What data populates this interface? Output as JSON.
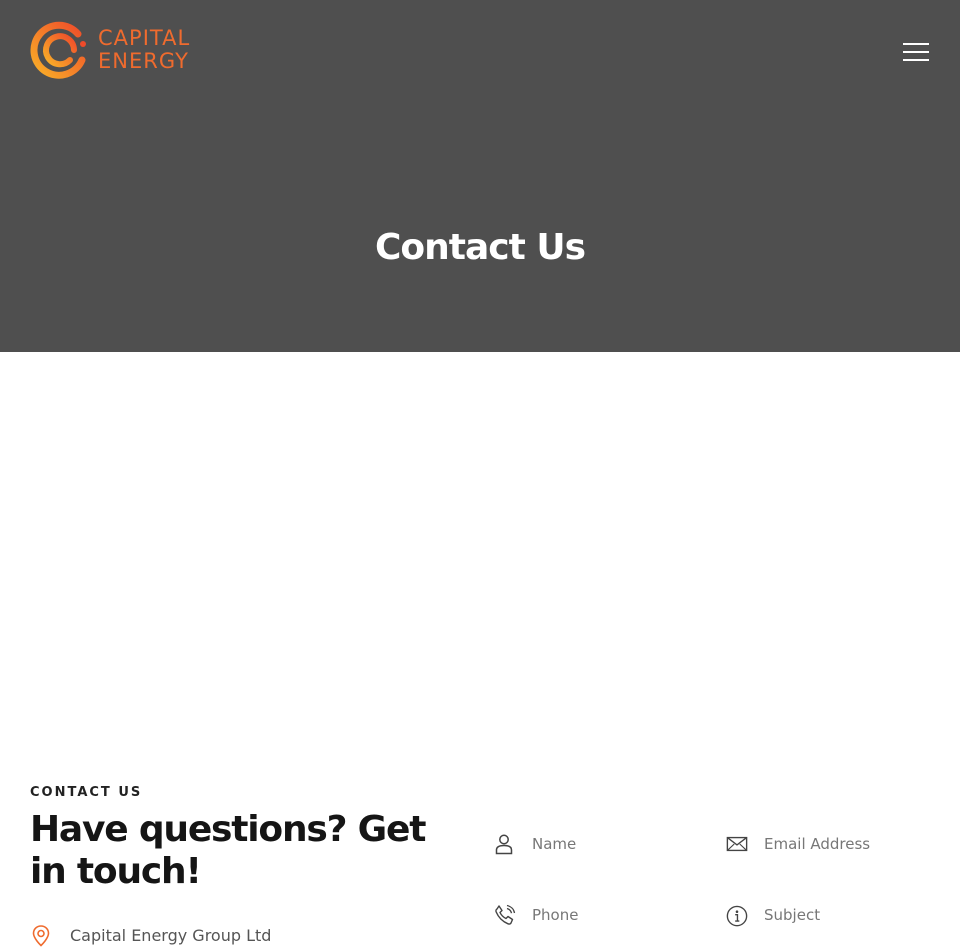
{
  "header": {
    "logo": {
      "line1": "CAPITAL",
      "line2": "ENERGY"
    },
    "menu_icon": "hamburger-menu-icon"
  },
  "hero": {
    "title": "Contact Us"
  },
  "contact": {
    "eyebrow": "CONTACT US",
    "heading": "Have questions? Get in touch!",
    "company": "Capital Energy Group Ltd"
  },
  "form": {
    "name_placeholder": "Name",
    "email_placeholder": "Email Address",
    "phone_placeholder": "Phone",
    "subject_placeholder": "Subject"
  },
  "colors": {
    "hero_bg": "#4f4f4f",
    "brand_orange": "#ef6b2e",
    "brand_yellow": "#f9b128"
  }
}
